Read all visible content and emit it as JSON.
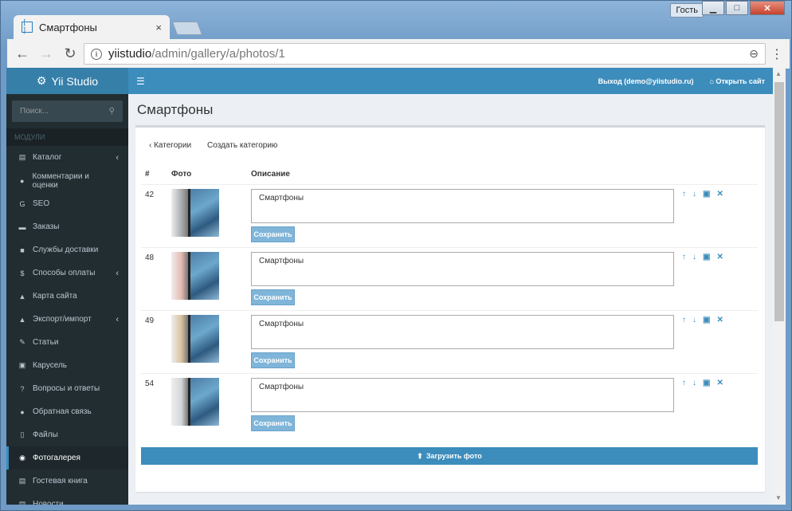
{
  "window": {
    "guest_label": "Гость",
    "min": "▁",
    "max": "□",
    "close": "✕"
  },
  "tab": {
    "icon": "[ ]",
    "title": "Смартфоны",
    "close": "×"
  },
  "address": {
    "host": "yiistudio",
    "path": "/admin/gallery/a/photos/1"
  },
  "sidebar": {
    "logo": "Yii Studio",
    "search_placeholder": "Поиск...",
    "section": "МОДУЛИ",
    "items": [
      {
        "icon": "▤",
        "label": "Каталог",
        "caret": "‹"
      },
      {
        "icon": "●",
        "label": "Комментарии и оценки",
        "caret": ""
      },
      {
        "icon": "G",
        "label": "SEO",
        "caret": ""
      },
      {
        "icon": "▬",
        "label": "Заказы",
        "caret": ""
      },
      {
        "icon": "■",
        "label": "Службы доставки",
        "caret": ""
      },
      {
        "icon": "$",
        "label": "Способы оплаты",
        "caret": "‹"
      },
      {
        "icon": "▲",
        "label": "Карта сайта",
        "caret": ""
      },
      {
        "icon": "▲",
        "label": "Экспорт/импорт",
        "caret": "‹"
      },
      {
        "icon": "✎",
        "label": "Статьи",
        "caret": ""
      },
      {
        "icon": "▣",
        "label": "Карусель",
        "caret": ""
      },
      {
        "icon": "?",
        "label": "Вопросы и ответы",
        "caret": ""
      },
      {
        "icon": "●",
        "label": "Обратная связь",
        "caret": ""
      },
      {
        "icon": "▯",
        "label": "Файлы",
        "caret": ""
      },
      {
        "icon": "◉",
        "label": "Фотогалерея",
        "caret": "",
        "active": true
      },
      {
        "icon": "▤",
        "label": "Гостевая книга",
        "caret": ""
      },
      {
        "icon": "▤",
        "label": "Новости",
        "caret": ""
      }
    ]
  },
  "header": {
    "logout": "Выход (demo@yiistudio.ru)",
    "open_site": "Открыть сайт"
  },
  "page": {
    "title": "Смартфоны",
    "back_link": "Категории",
    "create_link": "Создать категорию",
    "columns": [
      "#",
      "Фото",
      "Описание"
    ],
    "rows": [
      {
        "id": "42",
        "description": "Смартфоны",
        "save": "Сохранить",
        "edge_color": "#a9adb1"
      },
      {
        "id": "48",
        "description": "Смартфоны",
        "save": "Сохранить",
        "edge_color": "#e6b9b1"
      },
      {
        "id": "49",
        "description": "Смартфоны",
        "save": "Сохранить",
        "edge_color": "#d9c19e"
      },
      {
        "id": "54",
        "description": "Смартфоны",
        "save": "Сохранить",
        "edge_color": "#d4d6d8"
      }
    ],
    "upload": "Загрузить фото"
  },
  "colors": {
    "accent": "#3c8dbc",
    "sidebar": "#222d32"
  }
}
